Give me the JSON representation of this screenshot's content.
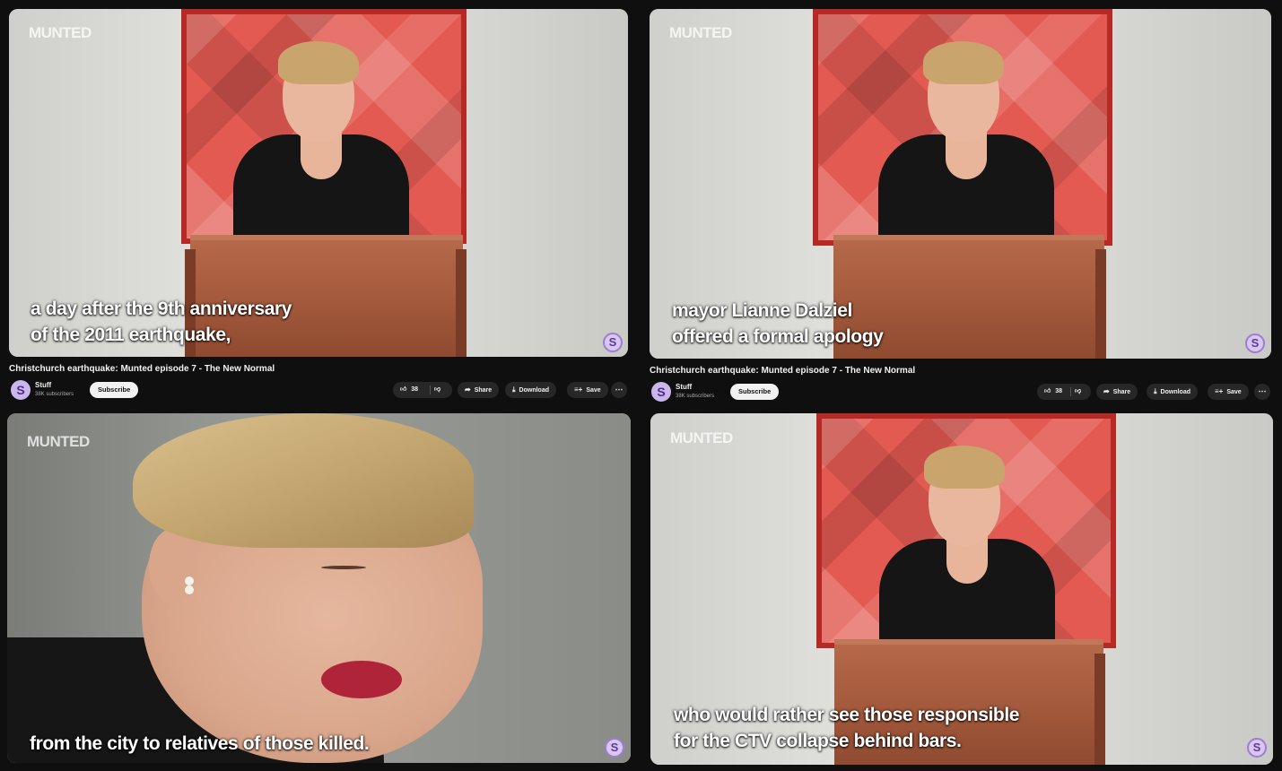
{
  "watermark": "MUNTED",
  "badge_letter": "S",
  "video_meta": {
    "title": "Christchurch earthquake: Munted episode 7 - The New Normal",
    "channel_name": "Stuff",
    "channel_subscribers": "38K subscribers",
    "channel_avatar_letter": "S",
    "subscribe_label": "Subscribe",
    "like_count": "38",
    "share_label": "Share",
    "download_label": "Download",
    "save_label": "Save",
    "more_label": "⋯"
  },
  "icons": {
    "like": "thumbs-up-icon",
    "dislike": "thumbs-down-icon",
    "share": "share-arrow-icon",
    "download": "download-icon",
    "save": "add-to-playlist-icon",
    "more": "more-icon"
  },
  "frames": [
    {
      "caption_line1": "a day after the 9th anniversary",
      "caption_line2": "of the 2011 earthquake,"
    },
    {
      "caption_line1": "mayor Lianne Dalziel",
      "caption_line2": "offered a formal apology"
    },
    {
      "caption_line1": "from the city to relatives of those killed.",
      "caption_line2": ""
    },
    {
      "caption_line1": "who would rather see those responsible",
      "caption_line2": "for the CTV collapse behind bars."
    }
  ],
  "colors": {
    "background": "#0f0f0f",
    "painting_red": "#e25a52",
    "podium_wood": "#a45a3c",
    "badge_purple": "#9b7fd1"
  }
}
